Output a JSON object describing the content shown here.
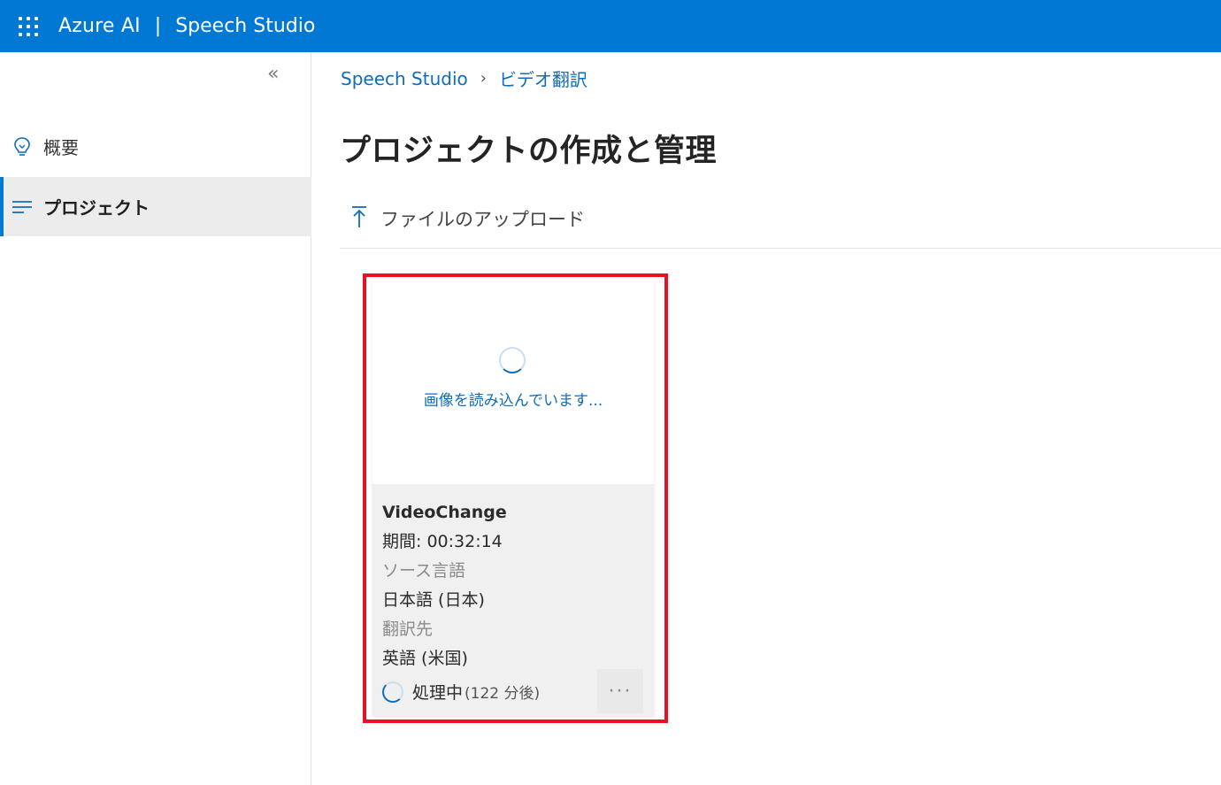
{
  "header": {
    "brand": "Azure AI",
    "separator": "|",
    "product": "Speech Studio"
  },
  "sidebar": {
    "collapse_glyph": "«",
    "items": [
      {
        "label": "概要",
        "icon": "lightbulb-icon",
        "selected": false
      },
      {
        "label": "プロジェクト",
        "icon": "list-icon",
        "selected": true
      }
    ]
  },
  "breadcrumb": {
    "root": "Speech Studio",
    "chevron": "›",
    "current": "ビデオ翻訳"
  },
  "page": {
    "title": "プロジェクトの作成と管理"
  },
  "toolbar": {
    "upload_label": "ファイルのアップロード",
    "upload_icon": "upload-arrow-icon"
  },
  "project_card": {
    "loading_text": "画像を読み込んでいます...",
    "name": "VideoChange",
    "duration": "期間: 00:32:14",
    "source_label": "ソース言語",
    "source_value": "日本語 (日本)",
    "target_label": "翻訳先",
    "target_value": "英語 (米国)",
    "status": "処理中",
    "eta": "(122 分後)",
    "more": "···"
  },
  "colors": {
    "accent": "#0078d4",
    "link": "#0f6cbd",
    "highlight": "#e81123"
  }
}
